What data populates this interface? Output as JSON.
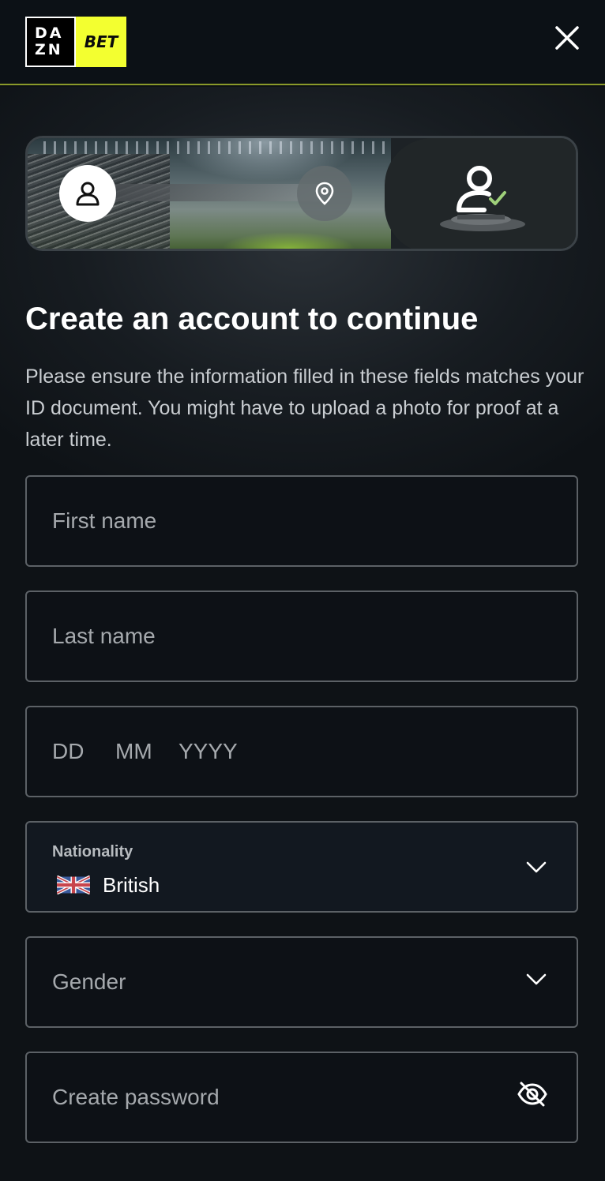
{
  "header": {
    "logo_dazn_top": "DA",
    "logo_dazn_bottom": "ZN",
    "logo_bet": "BET"
  },
  "stepper": {
    "steps": [
      "personal-details",
      "address",
      "verification"
    ],
    "current_step": 1
  },
  "page": {
    "title": "Create an account to continue",
    "subtitle": "Please ensure the information filled in these fields matches your ID document. You might have to upload a photo for proof at a later time."
  },
  "form": {
    "first_name_placeholder": "First name",
    "last_name_placeholder": "Last name",
    "dob": {
      "day_placeholder": "DD",
      "month_placeholder": "MM",
      "year_placeholder": "YYYY"
    },
    "nationality_label": "Nationality",
    "nationality_value": "British",
    "gender_placeholder": "Gender",
    "password_placeholder": "Create password"
  },
  "colors": {
    "accent": "#f3ff30",
    "background": "#0c1014",
    "field_border": "#5c6166"
  }
}
